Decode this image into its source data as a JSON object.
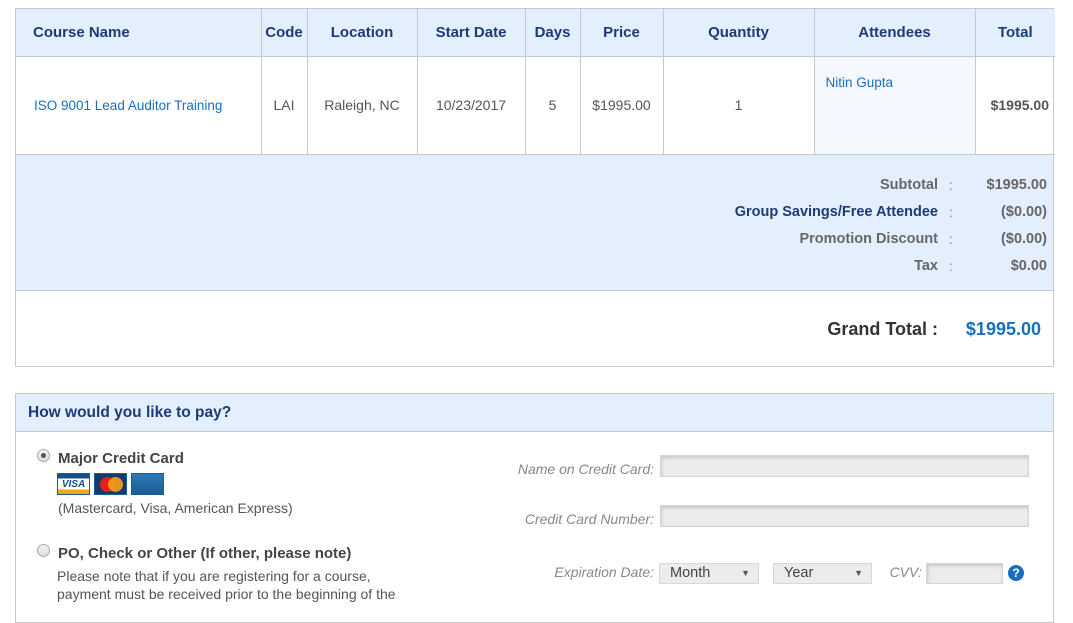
{
  "order": {
    "columns": [
      "Course Name",
      "Code",
      "Location",
      "Start Date",
      "Days",
      "Price",
      "Quantity",
      "Attendees",
      "Total"
    ],
    "rows": [
      {
        "course_name": "ISO 9001 Lead Auditor Training",
        "code": "LAI",
        "location": "Raleigh, NC",
        "start_date": "10/23/2017",
        "days": "5",
        "price": "$1995.00",
        "quantity": "1",
        "attendees": [
          "Nitin Gupta"
        ],
        "total": "$1995.00"
      }
    ],
    "summary": [
      {
        "label": "Subtotal",
        "value": "$1995.00"
      },
      {
        "label": "Group Savings/Free Attendee",
        "value": "($0.00)"
      },
      {
        "label": "Promotion Discount",
        "value": "($0.00)"
      },
      {
        "label": "Tax",
        "value": "$0.00"
      }
    ],
    "colon": ":",
    "grand_total_label": "Grand Total :",
    "grand_total_value": "$1995.00"
  },
  "payment": {
    "heading": "How would you like to pay?",
    "options": [
      {
        "label": "Major Credit Card",
        "selected": true,
        "note": "(Mastercard, Visa, American Express)"
      },
      {
        "label": "PO, Check or Other (If other, please note)",
        "selected": false,
        "note_lines": [
          "Please note that if you are registering for a course,",
          "payment must be received prior to the beginning of the"
        ]
      }
    ],
    "cards": [
      "VISA",
      "MasterCard",
      "American Express"
    ],
    "fields": {
      "name_label": "Name on Credit Card:",
      "name_value": "",
      "number_label": "Credit Card Number:",
      "number_value": "",
      "expiration_label": "Expiration Date:",
      "month_selected": "Month",
      "year_selected": "Year",
      "cvv_label": "CVV:",
      "cvv_value": ""
    },
    "help_glyph": "?"
  },
  "colors": {
    "accent_blue": "#1a6fc0",
    "header_navy": "#1d3b78",
    "header_bg": "#e3effd"
  }
}
